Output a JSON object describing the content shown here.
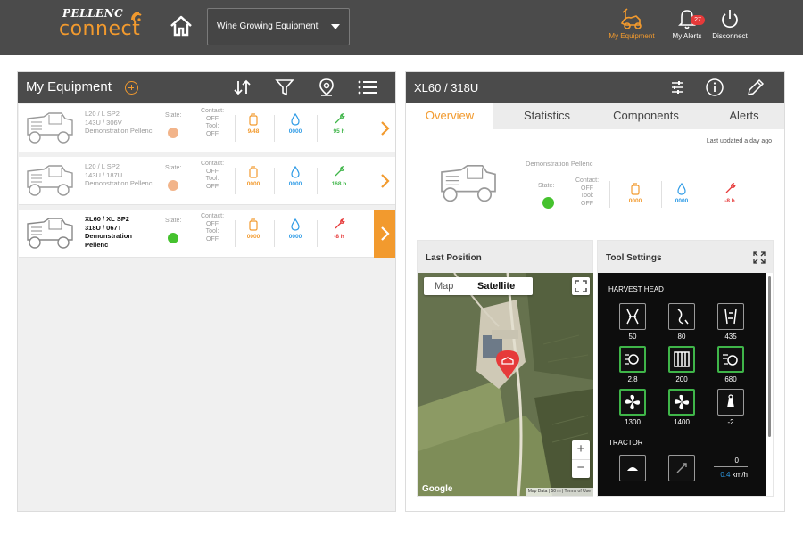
{
  "header": {
    "brand": "PELLENC",
    "app_name": "connect",
    "selector_value": "Wine Growing Equipment",
    "actions": [
      {
        "label": "My Equipment",
        "active": true
      },
      {
        "label": "My Alerts",
        "badge": "27"
      },
      {
        "label": "Disconnect"
      }
    ]
  },
  "list_panel": {
    "title": "My Equipment",
    "items": [
      {
        "model": "L20 / L SP2",
        "serial": "143U / 306V",
        "owner": "Demonstration Pellenc",
        "state_label": "State:",
        "state_color": "#f2b48a",
        "contact": "Contact:",
        "contact_val": "OFF",
        "tool": "Tool:",
        "tool_val": "OFF",
        "fuel": "9/48",
        "water": "0000",
        "hours": "95 h",
        "hours_color": "#3fb549"
      },
      {
        "model": "L20 / L SP2",
        "serial": "143U / 187U",
        "owner": "Demonstration Pellenc",
        "state_label": "State:",
        "state_color": "#f2b48a",
        "contact": "Contact:",
        "contact_val": "OFF",
        "tool": "Tool:",
        "tool_val": "OFF",
        "fuel": "0000",
        "water": "0000",
        "hours": "168 h",
        "hours_color": "#3fb549"
      },
      {
        "model": "XL60 / XL SP2",
        "serial": "318U / 067T",
        "owner": "Demonstration Pellenc",
        "state_label": "State:",
        "state_color": "#45c22e",
        "contact": "Contact:",
        "contact_val": "OFF",
        "tool": "Tool:",
        "tool_val": "OFF",
        "fuel": "0000",
        "water": "0000",
        "hours": "-8 h",
        "hours_color": "#e63a3a"
      }
    ]
  },
  "detail_panel": {
    "title": "XL60 / 318U",
    "tabs": [
      "Overview",
      "Statistics",
      "Components",
      "Alerts"
    ],
    "last_updated": "Last updated a day ago",
    "owner": "Demonstration Pellenc",
    "state_label": "State:",
    "state_color": "#45c22e",
    "contact": "Contact:",
    "contact_val": "OFF",
    "tool": "Tool:",
    "tool_val": "OFF",
    "fuel": "0000",
    "water": "0000",
    "hours": "-8 h",
    "last_position": {
      "title": "Last Position",
      "map_label": "Map",
      "satellite_label": "Satellite",
      "google": "Google",
      "footer": "Map Data  |  50 m  |  Terms of Use"
    },
    "tool_settings": {
      "title": "Tool Settings",
      "harvest_head_label": "HARVEST HEAD",
      "harvest_values": [
        "50",
        "80",
        "435",
        "2.8",
        "200",
        "680",
        "1300",
        "1400",
        "-2"
      ],
      "tractor_label": "TRACTOR",
      "speed_value": "0",
      "speed_reading": "0.4",
      "speed_unit": " km/h"
    }
  },
  "colors": {
    "accent": "#f29a2e",
    "header_bg": "#4b4b4b",
    "ok_green": "#3fb549",
    "alert_red": "#e63a3a",
    "water_blue": "#2e9be6"
  }
}
